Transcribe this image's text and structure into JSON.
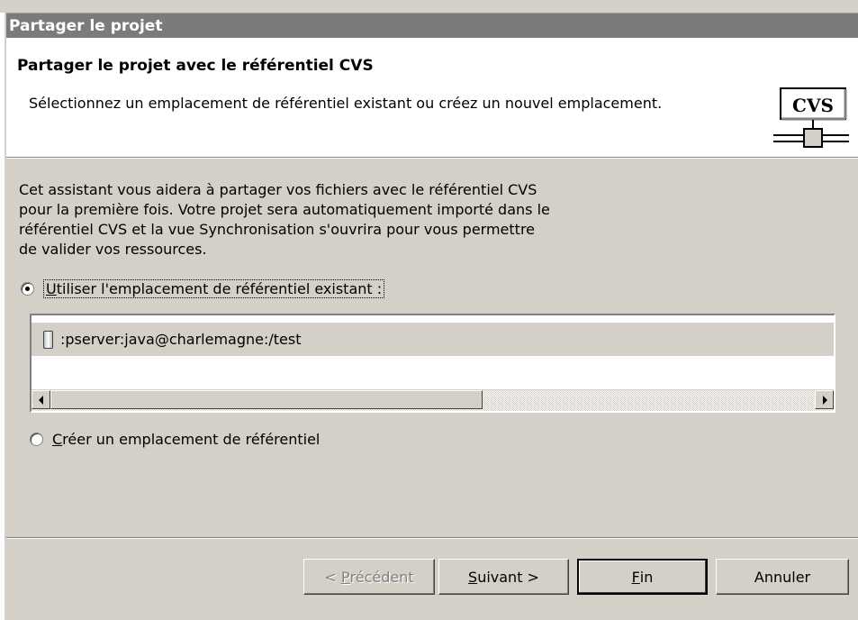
{
  "window": {
    "title": "Partager le projet"
  },
  "header": {
    "title": "Partager le projet avec le référentiel CVS",
    "description": "Sélectionnez un emplacement de référentiel existant ou créez un nouvel emplacement.",
    "logo_text": "CVS"
  },
  "intro": {
    "lines": [
      "Cet assistant vous aidera à partager vos fichiers avec le référentiel CVS",
      "pour la première fois. Votre projet sera automatiquement importé dans le",
      "référentiel CVS et la vue Synchronisation s'ouvrira pour vous permettre",
      "de valider vos ressources."
    ]
  },
  "options": {
    "existing": {
      "mnemonic": "U",
      "label_rest": "tiliser l'emplacement de référentiel existant :",
      "checked": true
    },
    "create": {
      "mnemonic": "C",
      "label_rest": "réer un emplacement de référentiel",
      "checked": false
    }
  },
  "repositories": [
    {
      "location": ":pserver:java@charlemagne:/test",
      "icon": "repository-icon"
    }
  ],
  "buttons": {
    "back": {
      "prefix": "< ",
      "mnemonic": "P",
      "rest": "récédent"
    },
    "next": {
      "mnemonic": "S",
      "rest": "uivant >"
    },
    "finish": {
      "mnemonic": "F",
      "rest": "in"
    },
    "cancel": {
      "label": "Annuler"
    }
  }
}
